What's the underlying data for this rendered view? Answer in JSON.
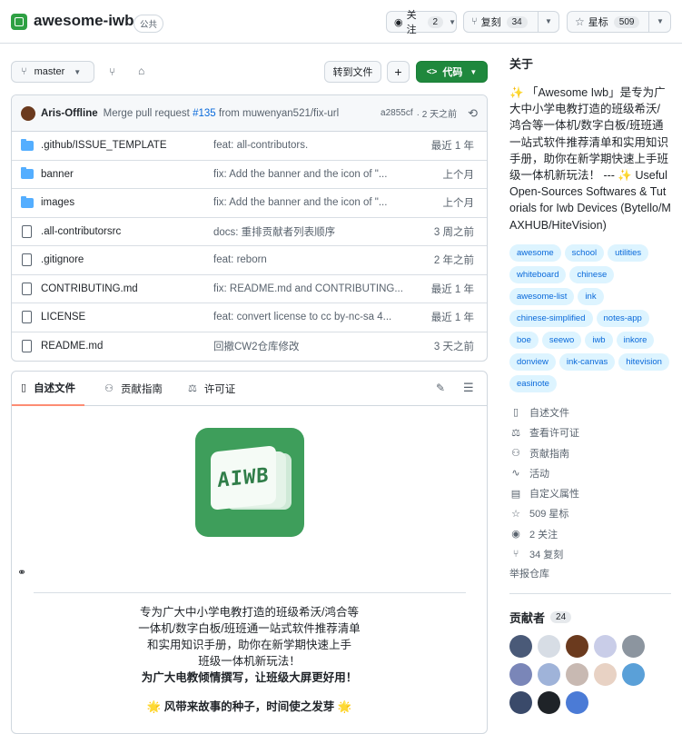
{
  "repo": {
    "name": "awesome-iwb",
    "visibility": "公共",
    "watch_label": "关注",
    "watch_count": "2",
    "fork_label": "复刻",
    "fork_count": "34",
    "star_label": "星标",
    "star_count": "509"
  },
  "toolbar": {
    "branch": "master",
    "goto_file": "转到文件",
    "plus": "+",
    "code_label": "代码"
  },
  "commit": {
    "author": "Aris-Offline",
    "message_prefix": "Merge pull request ",
    "pr": "#135",
    "message_suffix": " from muwenyan521/fix-url",
    "sha": "a2855cf",
    "time": "· 2 天之前"
  },
  "files": [
    {
      "type": "folder",
      "name": ".github/ISSUE_TEMPLATE",
      "message": "feat: all-contributors.",
      "date": "最近 1 年"
    },
    {
      "type": "folder",
      "name": "banner",
      "message": "fix: Add the banner and the icon of \"...",
      "date": "上个月"
    },
    {
      "type": "folder",
      "name": "images",
      "message": "fix: Add the banner and the icon of \"...",
      "date": "上个月"
    },
    {
      "type": "file",
      "name": ".all-contributorsrc",
      "message": "docs: 重排贡献者列表顺序",
      "date": "3 周之前"
    },
    {
      "type": "file",
      "name": ".gitignore",
      "message": "feat: reborn",
      "date": "2 年之前"
    },
    {
      "type": "file",
      "name": "CONTRIBUTING.md",
      "message": "fix: README.md and CONTRIBUTING...",
      "date": "最近 1 年"
    },
    {
      "type": "file",
      "name": "LICENSE",
      "message": "feat: convert license to cc by-nc-sa 4...",
      "date": "最近 1 年"
    },
    {
      "type": "file",
      "name": "README.md",
      "message": "回撤CW2仓库修改",
      "date": "3 天之前"
    }
  ],
  "readme_tabs": {
    "readme": "自述文件",
    "contributing": "贡献指南",
    "license": "许可证"
  },
  "readme": {
    "logo_text": "AIWB",
    "lines": [
      "专为广大中小学电教打造的班级希沃/鸿合等",
      "一体机/数字白板/班班通一站式软件推荐清单",
      "和实用知识手册，助你在新学期快速上手",
      "班级一体机新玩法！"
    ],
    "bold_line": "为广大电教倾情撰写，让班级大屏更好用！",
    "motto": "🌟 风带来故事的种子，时间使之发芽 🌟"
  },
  "about": {
    "title": "关于",
    "description": "✨ 「Awesome Iwb」是专为广大中小学电教打造的班级希沃/鸿合等一体机/数字白板/班班通一站式软件推荐清单和实用知识手册，助你在新学期快速上手班级一体机新玩法！ --- ✨ Useful Open-Sources Softwares & Tutorials for Iwb Devices (Bytello/MAXHUB/HiteVision)",
    "topics": [
      "awesome",
      "school",
      "utilities",
      "whiteboard",
      "chinese",
      "awesome-list",
      "ink",
      "chinese-simplified",
      "notes-app",
      "boe",
      "seewo",
      "iwb",
      "inkore",
      "donview",
      "ink-canvas",
      "hitevision",
      "easinote"
    ],
    "links": [
      {
        "icon": "book-icon",
        "label": "自述文件"
      },
      {
        "icon": "scale-icon",
        "label": "查看许可证"
      },
      {
        "icon": "people-icon",
        "label": "贡献指南"
      },
      {
        "icon": "pulse-icon",
        "label": "活动"
      },
      {
        "icon": "note-icon",
        "label": "自定义属性"
      },
      {
        "icon": "star-icon",
        "label": "509 星标"
      },
      {
        "icon": "eye-icon",
        "label": "2 关注"
      },
      {
        "icon": "fork-icon",
        "label": "34 复刻"
      }
    ],
    "report": "举报仓库"
  },
  "contributors": {
    "title": "贡献者",
    "count": "24",
    "avatar_colors": [
      "#4a5a78",
      "#d7dde5",
      "#6b3a1e",
      "#c9cde8",
      "#8c959f",
      "#7a86b8",
      "#9fb3d9",
      "#c8b9b2",
      "#e8d2c4",
      "#5aa0d8",
      "#3a4a6a",
      "#1f2328",
      "#4b7bd6"
    ]
  }
}
